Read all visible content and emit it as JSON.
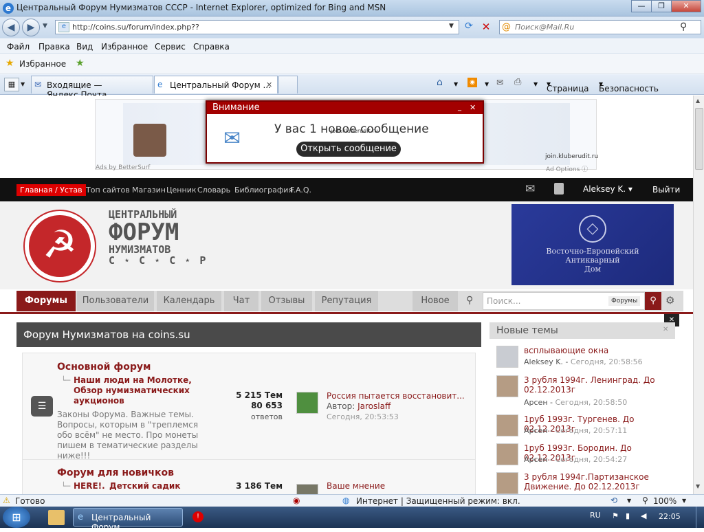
{
  "window": {
    "title": "Центральный Форум Нумизматов СССР - Internet Explorer, optimized for Bing and MSN"
  },
  "address": {
    "url": "http://coins.su/forum/index.php??"
  },
  "search": {
    "placeholder": "Поиск@Mail.Ru"
  },
  "menu": {
    "items": [
      "Файл",
      "Правка",
      "Вид",
      "Избранное",
      "Сервис",
      "Справка"
    ]
  },
  "favorites": {
    "label": "Избранное"
  },
  "tabs": [
    {
      "label": "Входящие — Яндекс.Почта"
    },
    {
      "label": "Центральный Форум ..."
    }
  ],
  "commandbar": {
    "page": "Страница",
    "safety": "Безопасность"
  },
  "ad": {
    "provider": "Ads by BetterSurf",
    "options": "Ad Options",
    "domain": "join.kluberudit.ru",
    "alert_title": "Внимание",
    "alert_msg": "У вас 1 новое сообщение",
    "alert_btn": "Открыть сообщение"
  },
  "topnav": {
    "home": "Главная / Устав",
    "links": [
      "Топ сайтов",
      "Магазин",
      "Ценник",
      "Словарь",
      "Библиография",
      "F.A.Q."
    ],
    "user": "Aleksey K.",
    "logout": "Выйти"
  },
  "logo": {
    "l1": "ЦЕНТРАЛЬНЫЙ",
    "l2": "ФОРУМ",
    "l3": "НУМИЗМАТОВ",
    "l4": "С ⋆ С ⋆ С ⋆ Р"
  },
  "banner": {
    "l1": "Восточно-Европейский",
    "l2": "Антикварный",
    "l3": "Дом"
  },
  "forumtabs": {
    "items": [
      "Форумы",
      "Пользователи",
      "Календарь",
      "Чат",
      "Отзывы",
      "Репутация"
    ],
    "new": "Новое",
    "search_ph": "Поиск...",
    "scope": "Форумы"
  },
  "forum": {
    "header": "Форум Нумизматов на coins.su",
    "cat1": {
      "title": "Основной форум",
      "sub": "Наши люди на Молотке, Обзор нумизматических аукционов",
      "desc": "Законы Форума. Важные темы. Вопросы, которым в \"треплемся обо всём\" не место. Про монеты пишем в тематические разделы ниже!!!",
      "topics": "5 215 Тем",
      "replies": "80 653",
      "replies_label": "ответов",
      "last_title": "Россия пытается восстановит...",
      "last_author_label": "Автор:",
      "last_author": "Jaroslaff",
      "last_time": "Сегодня, 20:53:53"
    },
    "cat2": {
      "title": "Форум для новичков",
      "sub1": "HERE!.",
      "sub2": "Детский садик",
      "topics": "3 186 Тем",
      "last_title": "Ваше мнение"
    }
  },
  "sidebar": {
    "title": "Новые темы",
    "items": [
      {
        "title": "всплывающие окна",
        "author": "Aleksey K.",
        "time": "Сегодня, 20:58:56"
      },
      {
        "title": "3 рубля 1994г. Ленинград. До 02.12.2013г",
        "author": "Арсен",
        "time": "Сегодня, 20:58:50"
      },
      {
        "title": "1руб 1993г. Тургенев. До 02.12.2013г",
        "author": "Арсен",
        "time": "Сегодня, 20:57:11"
      },
      {
        "title": "1руб 1993г. Бородин. До 02.12.2013г",
        "author": "Арсен",
        "time": "Сегодня, 20:54:27"
      },
      {
        "title": "3 рубля 1994г.Партизанское Движение. До 02.12.2013г",
        "author": "",
        "time": ""
      }
    ]
  },
  "status": {
    "ready": "Готово",
    "zone": "Интернет | Защищенный режим: вкл.",
    "zoom": "100%"
  },
  "taskbar": {
    "task": "Центральный Форум...",
    "lang": "RU",
    "clock": "22:05"
  }
}
